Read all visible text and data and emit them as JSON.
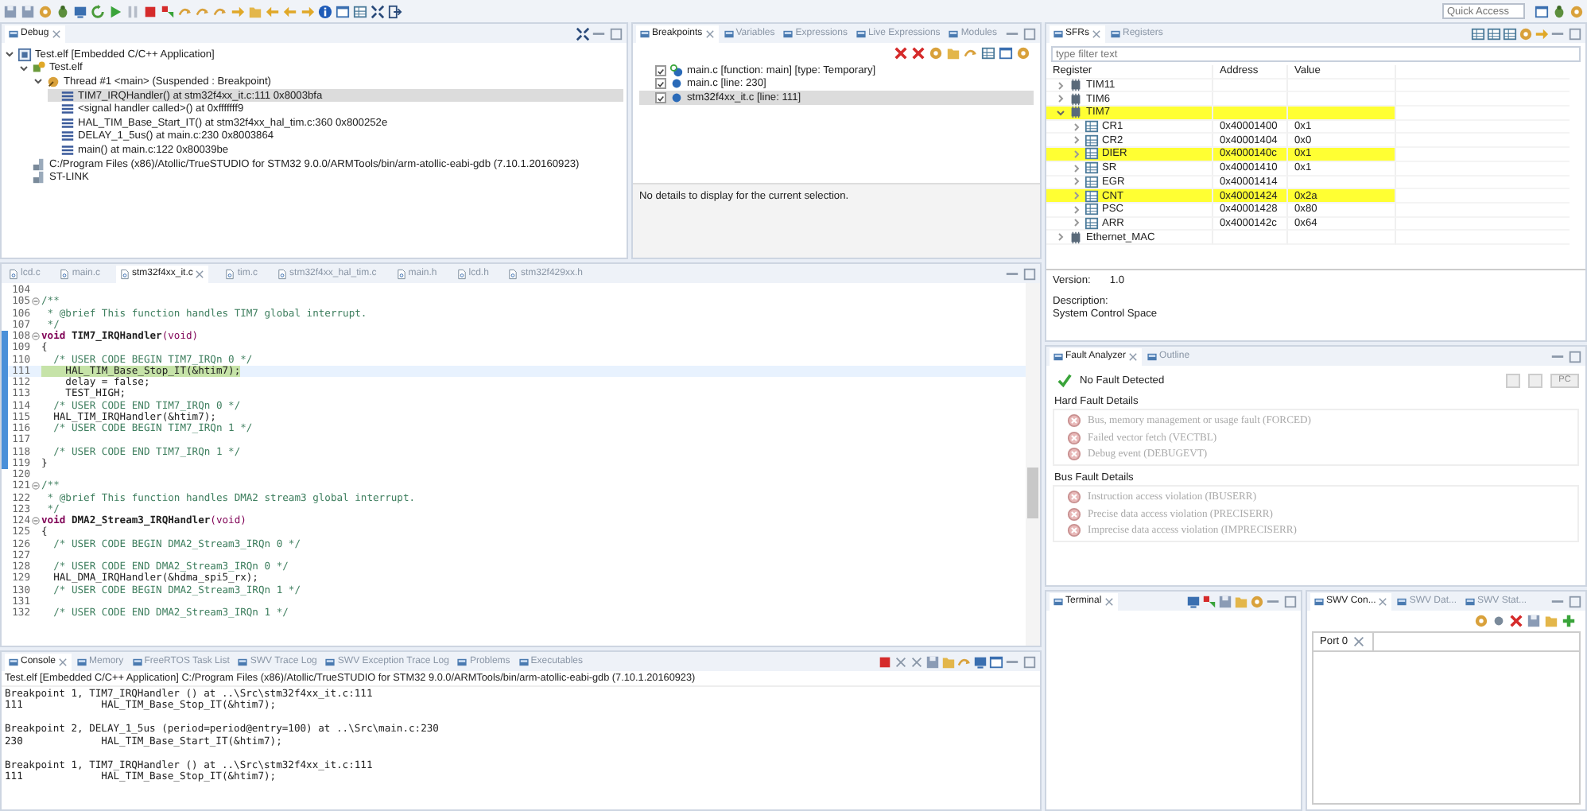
{
  "toolbar": {
    "quick_access": {
      "placeholder": "Quick Access"
    }
  },
  "debug": {
    "tabs": [
      {
        "label": "Debug",
        "selected": true
      }
    ],
    "tree": [
      {
        "label": "Test.elf [Embedded C/C++ Application]",
        "kind": "app",
        "expanded": true,
        "selected": false,
        "children": [
          {
            "label": "Test.elf",
            "kind": "process",
            "expanded": true,
            "selected": false,
            "children": [
              {
                "label": "Thread #1 <main> (Suspended : Breakpoint)",
                "kind": "thread",
                "expanded": true,
                "selected": false,
                "children": [
                  {
                    "label": "TIM7_IRQHandler() at stm32f4xx_it.c:111 0x8003bfa",
                    "kind": "frame",
                    "selected": true
                  },
                  {
                    "label": "<signal handler called>() at 0xfffffff9",
                    "kind": "frame",
                    "selected": false
                  },
                  {
                    "label": "HAL_TIM_Base_Start_IT() at stm32f4xx_hal_tim.c:360 0x800252e",
                    "kind": "frame",
                    "selected": false
                  },
                  {
                    "label": "DELAY_1_5us() at main.c:230 0x8003864",
                    "kind": "frame",
                    "selected": false
                  },
                  {
                    "label": "main() at main.c:122 0x80039be",
                    "kind": "frame",
                    "selected": false
                  }
                ]
              }
            ]
          },
          {
            "label": "C:/Program Files (x86)/Atollic/TrueSTUDIO for STM32 9.0.0/ARMTools/bin/arm-atollic-eabi-gdb (7.10.1.20160923)",
            "kind": "gdb",
            "selected": false
          },
          {
            "label": "ST-LINK",
            "kind": "gdb",
            "selected": false
          }
        ]
      }
    ]
  },
  "breakpoints": {
    "tabs": [
      {
        "label": "Breakpoints",
        "selected": true
      },
      {
        "label": "Variables",
        "selected": false
      },
      {
        "label": "Expressions",
        "selected": false
      },
      {
        "label": "Live Expressions",
        "selected": false
      },
      {
        "label": "Modules",
        "selected": false
      }
    ],
    "items": [
      {
        "label": "main.c [function: main] [type: Temporary]",
        "checked": true,
        "selected": false,
        "kind": "temporary"
      },
      {
        "label": "main.c [line: 230]",
        "checked": true,
        "selected": false,
        "kind": "line"
      },
      {
        "label": "stm32f4xx_it.c [line: 111]",
        "checked": true,
        "selected": true,
        "kind": "line"
      }
    ],
    "details": "No details to display for the current selection."
  },
  "sfrs": {
    "tabs": [
      {
        "label": "SFRs",
        "selected": true
      },
      {
        "label": "Registers",
        "selected": false
      }
    ],
    "filter": {
      "placeholder": "type filter text"
    },
    "columns": [
      "Register",
      "Address",
      "Value"
    ],
    "rows": [
      {
        "name": "TIM11",
        "kind": "peripheral",
        "expanded": false,
        "highlighted": false
      },
      {
        "name": "TIM6",
        "kind": "peripheral",
        "expanded": false,
        "highlighted": false
      },
      {
        "name": "TIM7",
        "kind": "peripheral",
        "expanded": true,
        "highlighted": true,
        "children": [
          {
            "name": "CR1",
            "kind": "register",
            "address": "0x40001400",
            "value": "0x1",
            "expanded": false,
            "highlighted": false
          },
          {
            "name": "CR2",
            "kind": "register",
            "address": "0x40001404",
            "value": "0x0",
            "expanded": false,
            "highlighted": false
          },
          {
            "name": "DIER",
            "kind": "register",
            "address": "0x4000140c",
            "value": "0x1",
            "expanded": false,
            "highlighted": true
          },
          {
            "name": "SR",
            "kind": "register",
            "address": "0x40001410",
            "value": "0x1",
            "expanded": false,
            "highlighted": false
          },
          {
            "name": "EGR",
            "kind": "register",
            "address": "0x40001414",
            "expanded": false,
            "highlighted": false
          },
          {
            "name": "CNT",
            "kind": "register",
            "address": "0x40001424",
            "value": "0x2a",
            "expanded": false,
            "highlighted": true
          },
          {
            "name": "PSC",
            "kind": "register",
            "address": "0x40001428",
            "value": "0x80",
            "expanded": false,
            "highlighted": false
          },
          {
            "name": "ARR",
            "kind": "register",
            "address": "0x4000142c",
            "value": "0x64",
            "expanded": false,
            "highlighted": false
          }
        ]
      },
      {
        "name": "Ethernet_MAC",
        "kind": "peripheral",
        "expanded": false,
        "highlighted": false
      }
    ],
    "info": {
      "version_label": "Version:",
      "version": "1.0",
      "description_label": "Description:",
      "description": "System Control Space"
    }
  },
  "editor": {
    "tabs": [
      {
        "label": "lcd.c",
        "selected": false
      },
      {
        "label": "main.c",
        "selected": false
      },
      {
        "label": "stm32f4xx_it.c",
        "selected": true
      },
      {
        "label": "tim.c",
        "selected": false
      },
      {
        "label": "stm32f4xx_hal_tim.c",
        "selected": false
      },
      {
        "label": "main.h",
        "selected": false
      },
      {
        "label": "lcd.h",
        "selected": false
      },
      {
        "label": "stm32f429xx.h",
        "selected": false
      }
    ],
    "lines": [
      {
        "number": "104",
        "kind": "code"
      },
      {
        "number": "105",
        "kind": "comment",
        "text": "/**",
        "foldable": true
      },
      {
        "number": "106",
        "kind": "comment",
        "text": " * @brief This function handles TIM7 global interrupt."
      },
      {
        "number": "107",
        "kind": "comment",
        "text": " */"
      },
      {
        "number": "108",
        "kind": "declaration",
        "keyword": "void",
        "name": "TIM7_IRQHandler",
        "params": "(void)",
        "foldable": true,
        "scope": true
      },
      {
        "number": "109",
        "kind": "code",
        "text": "{",
        "scope": true
      },
      {
        "number": "110",
        "kind": "comment",
        "text": "  /* USER CODE BEGIN TIM7_IRQn 0 */",
        "scope": true
      },
      {
        "number": "111",
        "kind": "code",
        "text": "    HAL_TIM_Base_Stop_IT(&htim7);",
        "current": true,
        "scope": true
      },
      {
        "number": "112",
        "kind": "code",
        "text": "    delay = false;",
        "scope": true
      },
      {
        "number": "113",
        "kind": "code",
        "text": "    TEST_HIGH;",
        "scope": true
      },
      {
        "number": "114",
        "kind": "comment",
        "text": "  /* USER CODE END TIM7_IRQn 0 */",
        "scope": true
      },
      {
        "number": "115",
        "kind": "code",
        "text": "  HAL_TIM_IRQHandler(&htim7);",
        "scope": true
      },
      {
        "number": "116",
        "kind": "comment",
        "text": "  /* USER CODE BEGIN TIM7_IRQn 1 */",
        "scope": true
      },
      {
        "number": "117",
        "kind": "code",
        "scope": true
      },
      {
        "number": "118",
        "kind": "comment",
        "text": "  /* USER CODE END TIM7_IRQn 1 */",
        "scope": true
      },
      {
        "number": "119",
        "kind": "code",
        "text": "}",
        "scope": true
      },
      {
        "number": "120",
        "kind": "code"
      },
      {
        "number": "121",
        "kind": "comment",
        "text": "/**",
        "foldable": true
      },
      {
        "number": "122",
        "kind": "comment",
        "text": " * @brief This function handles DMA2 stream3 global interrupt."
      },
      {
        "number": "123",
        "kind": "comment",
        "text": " */"
      },
      {
        "number": "124",
        "kind": "declaration",
        "keyword": "void",
        "name": "DMA2_Stream3_IRQHandler",
        "params": "(void)",
        "foldable": true
      },
      {
        "number": "125",
        "kind": "code",
        "text": "{"
      },
      {
        "number": "126",
        "kind": "comment",
        "text": "  /* USER CODE BEGIN DMA2_Stream3_IRQn 0 */"
      },
      {
        "number": "127",
        "kind": "code"
      },
      {
        "number": "128",
        "kind": "comment",
        "text": "  /* USER CODE END DMA2_Stream3_IRQn 0 */"
      },
      {
        "number": "129",
        "kind": "code",
        "text": "  HAL_DMA_IRQHandler(&hdma_spi5_rx);"
      },
      {
        "number": "130",
        "kind": "comment",
        "text": "  /* USER CODE BEGIN DMA2_Stream3_IRQn 1 */"
      },
      {
        "number": "131",
        "kind": "code"
      },
      {
        "number": "132",
        "kind": "comment",
        "text": "  /* USER CODE END DMA2_Stream3_IRQn 1 */"
      }
    ]
  },
  "console": {
    "tabs": [
      {
        "label": "Console",
        "selected": true
      },
      {
        "label": "Memory",
        "selected": false
      },
      {
        "label": "FreeRTOS Task List",
        "selected": false
      },
      {
        "label": "SWV Trace Log",
        "selected": false
      },
      {
        "label": "SWV Exception Trace Log",
        "selected": false
      },
      {
        "label": "Problems",
        "selected": false
      },
      {
        "label": "Executables",
        "selected": false
      }
    ],
    "header": "Test.elf [Embedded C/C++ Application] C:/Program Files (x86)/Atollic/TrueSTUDIO for STM32 9.0.0/ARMTools/bin/arm-atollic-eabi-gdb (7.10.1.20160923)",
    "entries": [
      {
        "lines": [
          "Breakpoint 1, TIM7_IRQHandler () at ..\\Src\\stm32f4xx_it.c:111",
          "111             HAL_TIM_Base_Stop_IT(&htim7);"
        ]
      },
      {
        "lines": [
          "Breakpoint 2, DELAY_1_5us (period=period@entry=100) at ..\\Src\\main.c:230",
          "230             HAL_TIM_Base_Start_IT(&htim7);"
        ]
      },
      {
        "lines": [
          "Breakpoint 1, TIM7_IRQHandler () at ..\\Src\\stm32f4xx_it.c:111",
          "111             HAL_TIM_Base_Stop_IT(&htim7);"
        ]
      }
    ]
  },
  "fault_analyzer": {
    "tabs": [
      {
        "label": "Fault Analyzer",
        "selected": true
      },
      {
        "label": "Outline",
        "selected": false
      }
    ],
    "status": "No Fault Detected",
    "pc_button": {
      "label": "PC",
      "disabled": true
    },
    "groups": [
      {
        "title": "Hard Fault Details",
        "items": [
          {
            "label": "Bus, memory management or usage fault (FORCED)",
            "disabled": true
          },
          {
            "label": "Failed vector fetch (VECTBL)",
            "disabled": true
          },
          {
            "label": "Debug event (DEBUGEVT)",
            "disabled": true
          }
        ]
      },
      {
        "title": "Bus Fault Details",
        "items": [
          {
            "label": "Instruction access violation (IBUSERR)",
            "disabled": true
          },
          {
            "label": "Precise data access violation (PRECISERR)",
            "disabled": true
          },
          {
            "label": "Imprecise data access violation (IMPRECISERR)",
            "disabled": true
          }
        ]
      }
    ]
  },
  "terminal": {
    "tabs": [
      {
        "label": "Terminal",
        "selected": true
      }
    ]
  },
  "swv": {
    "tabs": [
      {
        "label": "SWV Con...",
        "selected": true
      },
      {
        "label": "SWV Dat...",
        "selected": false
      },
      {
        "label": "SWV Stat...",
        "selected": false
      }
    ],
    "port_tabs": [
      {
        "label": "Port 0",
        "selected": true
      }
    ]
  }
}
